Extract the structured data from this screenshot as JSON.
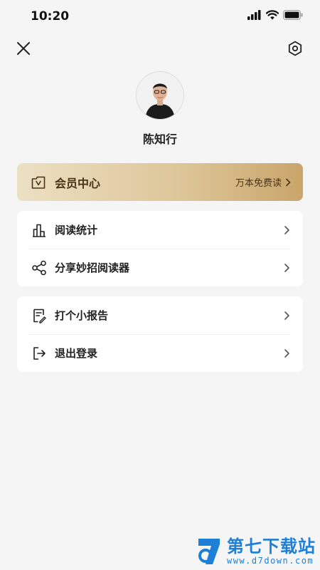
{
  "status_bar": {
    "time": "10:20"
  },
  "profile": {
    "name": "陈知行"
  },
  "vip": {
    "label": "会员中心",
    "promo": "万本免费读"
  },
  "menu_group_1": [
    {
      "label": "阅读统计",
      "icon": "bar-chart-icon"
    },
    {
      "label": "分享妙招阅读器",
      "icon": "share-icon"
    }
  ],
  "menu_group_2": [
    {
      "label": "打个小报告",
      "icon": "report-icon"
    },
    {
      "label": "退出登录",
      "icon": "logout-icon"
    }
  ],
  "watermark": {
    "title": "第七下载站",
    "url": "www.d7down.com"
  },
  "colors": {
    "background": "#f5f5f5",
    "vip_gold": "#d9c08f",
    "watermark_blue": "#1e7fd6"
  }
}
